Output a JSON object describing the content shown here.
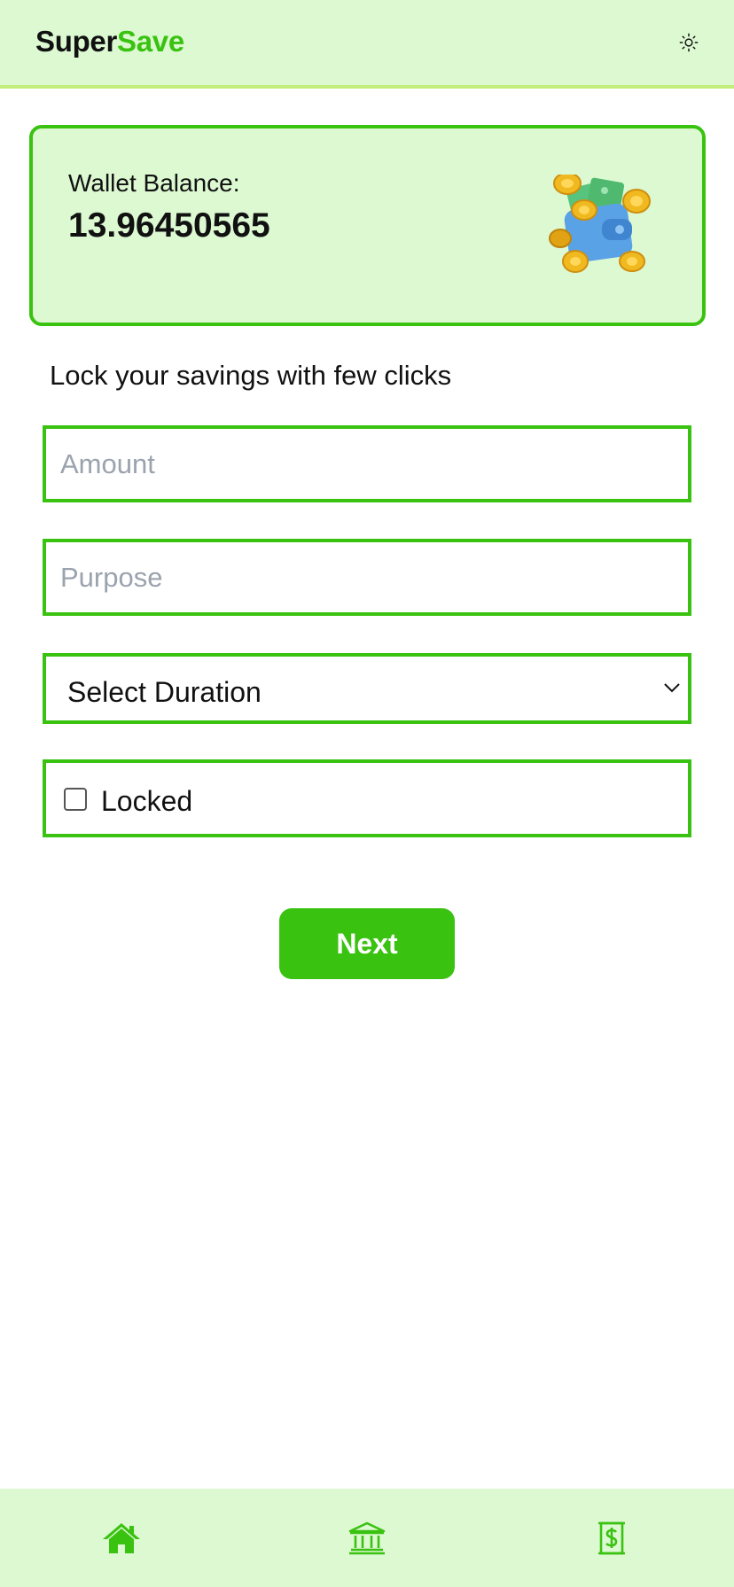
{
  "header": {
    "brand_part1": "Super",
    "brand_part2": "Save",
    "theme_icon": "sun-icon"
  },
  "wallet": {
    "label": "Wallet Balance:",
    "balance": "13.96450565",
    "illustration": "wallet-with-coins-illustration"
  },
  "form": {
    "heading": "Lock your savings with few clicks",
    "amount_placeholder": "Amount",
    "amount_value": "",
    "purpose_placeholder": "Purpose",
    "purpose_value": "",
    "duration_selected": "Select Duration",
    "locked_label": "Locked",
    "locked_checked": false,
    "next_label": "Next"
  },
  "bottom_nav": {
    "items": [
      {
        "icon": "home-icon"
      },
      {
        "icon": "bank-icon"
      },
      {
        "icon": "dollar-bill-icon"
      }
    ]
  },
  "colors": {
    "accent": "#3ac211",
    "header_bg": "#dcf9d2",
    "header_border": "#c3ee7c",
    "placeholder": "#9aa3ae"
  }
}
